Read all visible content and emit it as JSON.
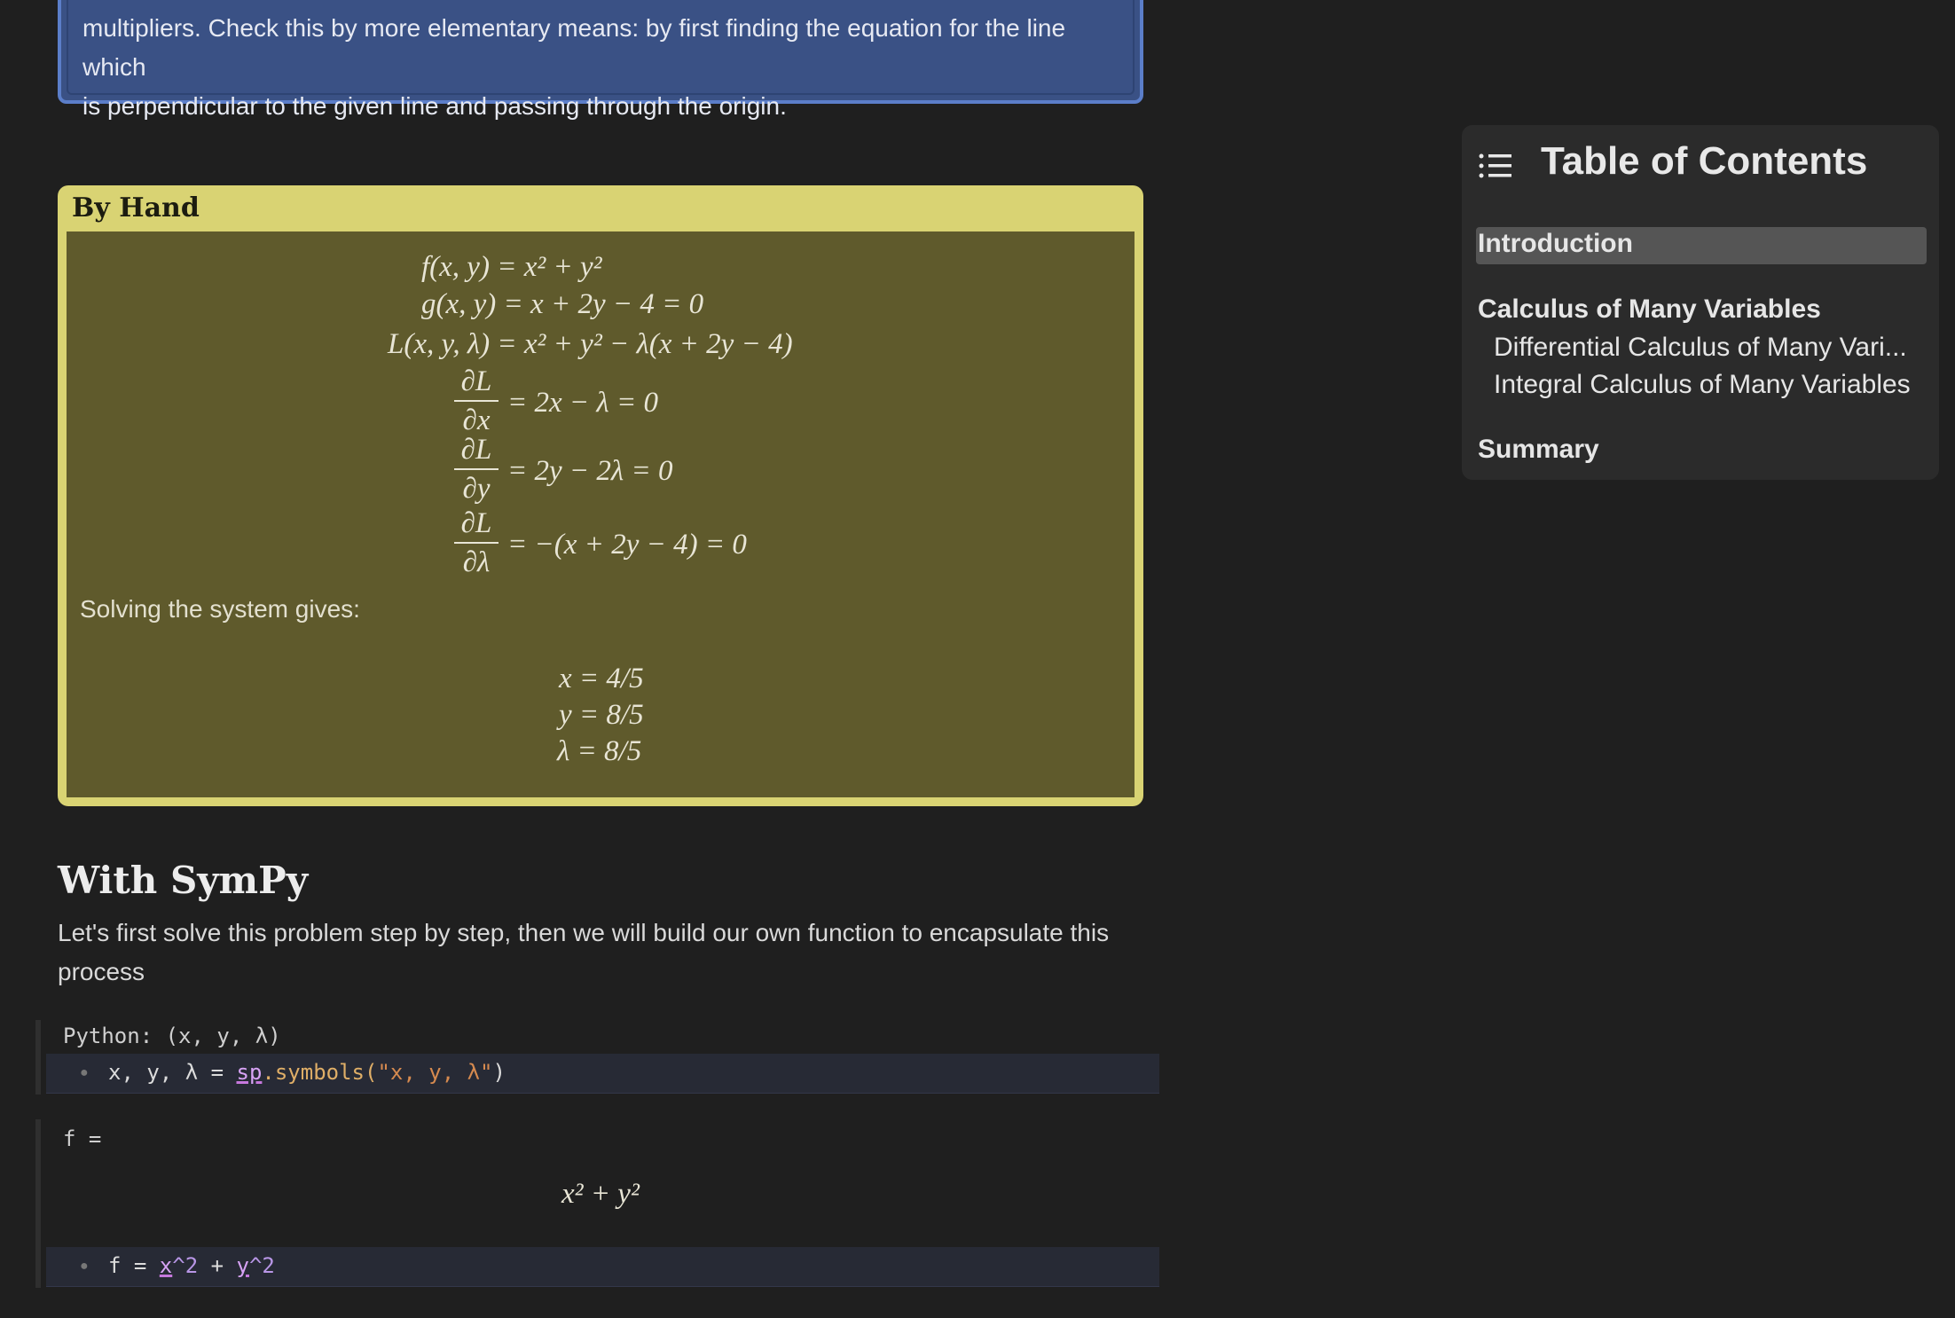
{
  "info_box": {
    "line1": "multipliers. Check this by more elementary means: by first finding the equation for the line which",
    "line2": "is perpendicular to the given line and passing through the origin."
  },
  "by_hand": {
    "title": "By Hand",
    "equations": [
      "f(x, y) = x² + y²",
      "g(x, y) = x + 2y − 4 = 0",
      "L(x, y, λ) = x² + y² − λ(x + 2y − 4)"
    ],
    "partials": [
      {
        "num": "∂L",
        "den": "∂x",
        "rhs": "= 2x − λ = 0"
      },
      {
        "num": "∂L",
        "den": "∂y",
        "rhs": "= 2y − 2λ = 0"
      },
      {
        "num": "∂L",
        "den": "∂λ",
        "rhs": "= −(x + 2y − 4) = 0"
      }
    ],
    "solving_text": "Solving the system gives:",
    "solutions": [
      "x = 4/5",
      "y = 8/5",
      "λ = 8/5"
    ]
  },
  "section": {
    "heading": "With SymPy",
    "paragraph": "Let's first solve this problem step by step, then we will build our own function to encapsulate this process"
  },
  "cell1": {
    "label": "Python: (x, y, λ)",
    "code_prefix": "x, y, λ = ",
    "code_module": "sp",
    "code_fn": ".symbols(",
    "code_str": "\"x, y, λ\"",
    "code_suffix": ")"
  },
  "cell2": {
    "label": "f =",
    "output": "x² + y²",
    "code_prefix": "f = ",
    "code_x": "x",
    "code_pow1": "^2",
    "code_plus": " + ",
    "code_y": "y",
    "code_pow2": "^2"
  },
  "toc": {
    "title": "Table of Contents",
    "icon": "list-icon",
    "items": [
      {
        "label": "Introduction",
        "bold": true,
        "active": true
      },
      {
        "label": "Calculus of Many Variables",
        "bold": true
      },
      {
        "label": "Differential Calculus of Many Vari...",
        "bold": false
      },
      {
        "label": "Integral Calculus of Many Variables",
        "bold": false
      },
      {
        "label": "Summary",
        "bold": true
      }
    ]
  },
  "colors": {
    "background": "#1f1f1f",
    "info_box": "#3a5185",
    "info_border": "#5b7ec9",
    "hand_header": "#d9d373",
    "hand_body": "#5f5a2c",
    "toc_bg": "#2b2b2b"
  }
}
